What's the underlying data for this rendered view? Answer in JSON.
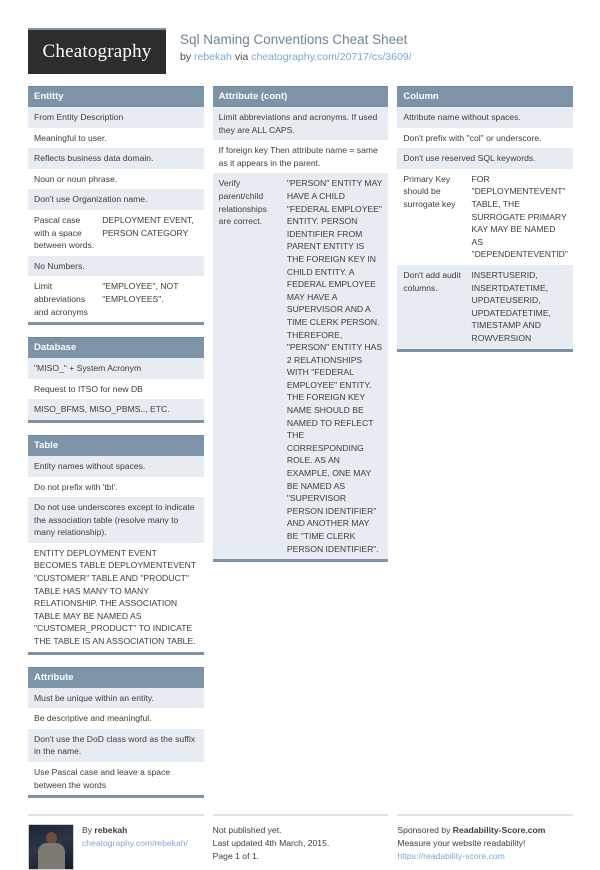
{
  "header": {
    "logo": "Cheatography",
    "title": "Sql Naming Conventions Cheat Sheet",
    "by_prefix": "by ",
    "author": "rebekah",
    "via": " via ",
    "source_url": "cheatography.com/20717/cs/3609/"
  },
  "columns": [
    {
      "name": "column-1",
      "blocks": [
        {
          "title": "Entitty",
          "rows": [
            {
              "key": "From Entity Description",
              "value": ""
            },
            {
              "key": "Meaningful to user.",
              "value": ""
            },
            {
              "key": "Reflects business data domain.",
              "value": ""
            },
            {
              "key": "Noun or noun phrase.",
              "value": ""
            },
            {
              "key": "Don't use Organization name.",
              "value": ""
            },
            {
              "key": "Pascal case with a space between words.",
              "value": "DEPLOYMENT EVENT, PERSON CATEGORY"
            },
            {
              "key": "No Numbers.",
              "value": ""
            },
            {
              "key": "Limit abbreviations and acronyms",
              "value": "\"EMPLOYEE\", NOT \"EMPLOYEES\"."
            }
          ]
        },
        {
          "title": "Database",
          "rows": [
            {
              "key": "\"MISO_\" + System Acronym",
              "value": ""
            },
            {
              "key": "Request to ITSO for new DB",
              "value": ""
            },
            {
              "key": "MISO_BFMS, MISO_PBMS.., ETC.",
              "value": ""
            }
          ]
        },
        {
          "title": "Table",
          "rows": [
            {
              "key": "Entity names without spaces.",
              "value": ""
            },
            {
              "key": "Do not prefix with 'tbl'.",
              "value": ""
            },
            {
              "key": "Do not use underscores except to indicate the association table (resolve many to many relationship).",
              "value": ""
            },
            {
              "key": "ENTITY DEPLOYMENT EVENT BECOMES TABLE DEPLOYMENTEVENT \"CUSTOMER\" TABLE AND \"PRODUCT\" TABLE HAS MANY TO MANY RELATIONSHIP. THE ASSOCIATION TABLE MAY BE NAMED AS \"CUSTOMER_PRODUCT\" TO INDICATE THE TABLE IS AN ASSOCIATION TABLE.",
              "value": ""
            }
          ]
        },
        {
          "title": "Attribute",
          "rows": [
            {
              "key": "Must be unique within an entity.",
              "value": ""
            },
            {
              "key": "Be descriptive and meaningful.",
              "value": ""
            },
            {
              "key": "Don't use the DoD class word as the suffix in the name.",
              "value": ""
            },
            {
              "key": "Use Pascal case and leave a space between the words",
              "value": ""
            }
          ]
        }
      ]
    },
    {
      "name": "column-2",
      "blocks": [
        {
          "title": "Attribute (cont)",
          "rows": [
            {
              "key": "Limit abbreviations and acronyms. If used they are ALL CAPS.",
              "value": ""
            },
            {
              "key": "If foreign key Then attribute name = same as it appears in the parent.",
              "value": ""
            },
            {
              "key": "Verify parent/child relationships are correct.",
              "value": "\"PERSON\" ENTITY MAY HAVE A CHILD \"FEDERAL EMPLOYEE\" ENTITY. PERSON IDENTIFIER FROM PARENT ENTITY IS THE FOREIGN KEY IN CHILD ENTITY. A FEDERAL EMPLOYEE MAY HAVE A SUPERVISOR AND A TIME CLERK PERSON. THEREFORE, \"PERSON\" ENTITY HAS 2 RELATIONSHIPS WITH \"FEDERAL EMPLOYEE\" ENTITY. THE FOREIGN KEY NAME SHOULD BE NAMED TO REFLECT THE CORRESPONDING ROLE. AS AN EXAMPLE, ONE MAY BE NAMED AS \"SUPERVISOR PERSON IDENTIFIER\" AND ANOTHER MAY BE \"TIME CLERK PERSON IDENTIFIER\"."
            }
          ]
        }
      ]
    },
    {
      "name": "column-3",
      "blocks": [
        {
          "title": "Column",
          "rows": [
            {
              "key": "Attribute name without spaces.",
              "value": ""
            },
            {
              "key": "Don't prefix with \"col\" or underscore.",
              "value": ""
            },
            {
              "key": "Don't use reserved SQL keywords.",
              "value": ""
            },
            {
              "key": "Primary Key should be surrogate key",
              "value": "FOR \"DEPLOYMENTEVENT\" TABLE, THE SURROGATE PRIMARY KAY MAY BE NAMED AS \"DEPENDENTEVENTID\""
            },
            {
              "key": "Don't add audit columns.",
              "value": "INSERTUSERID, INSERTDATETIME, UPDATEUSERID, UPDATEDATETIME, TIMESTAMP AND ROWVERSION"
            }
          ]
        }
      ]
    }
  ],
  "footer": {
    "author_prefix": "By ",
    "author": "rebekah",
    "author_url": "cheatography.com/rebekah/",
    "publish_status": "Not published yet.",
    "last_updated": "Last updated 4th March, 2015.",
    "pages": "Page 1 of 1.",
    "sponsor_prefix": "Sponsored by ",
    "sponsor": "Readability-Score.com",
    "sponsor_tagline": "Measure your website readability!",
    "sponsor_url": "https://readability-score.com"
  }
}
